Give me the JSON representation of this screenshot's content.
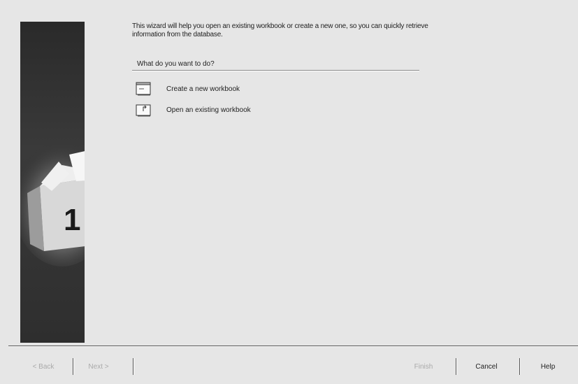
{
  "intro": {
    "text": "This wizard will help you open an existing workbook or create a new one, so you can quickly retrieve information from the database."
  },
  "question": {
    "label": "What do you want to do?"
  },
  "options": [
    {
      "label": "Create a new workbook",
      "icon": "new-workbook-icon"
    },
    {
      "label": "Open an existing workbook",
      "icon": "open-workbook-icon"
    }
  ],
  "banner": {
    "step_number": "1"
  },
  "buttons": {
    "back": "< Back",
    "next": "Next >",
    "finish": "Finish",
    "cancel": "Cancel",
    "help": "Help"
  }
}
